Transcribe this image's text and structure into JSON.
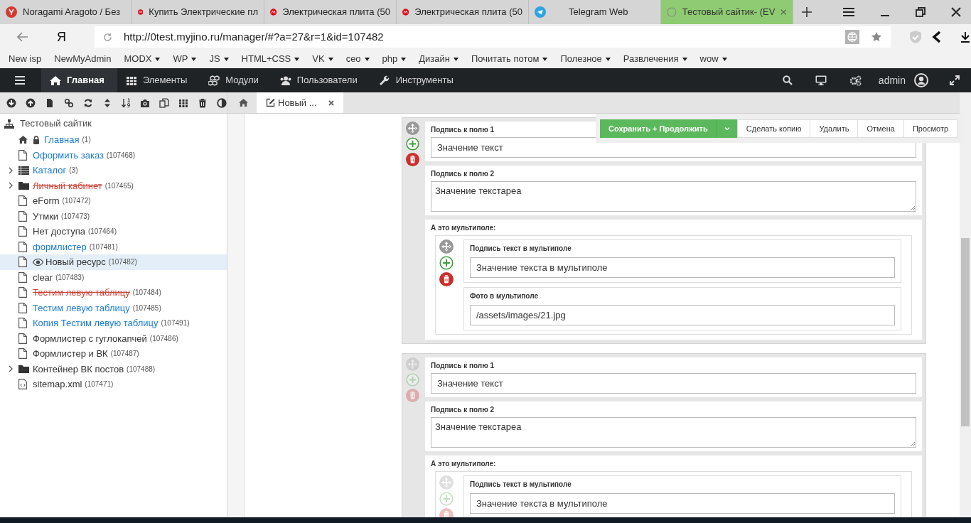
{
  "browser": {
    "tabs": [
      {
        "kind": "yandex",
        "title": "Noragami Aragoto / Без",
        "selected": false
      },
      {
        "kind": "mvideo",
        "title": "Купить Электрические пл",
        "selected": false
      },
      {
        "kind": "mvideo",
        "title": "Электрическая плита (50",
        "selected": false
      },
      {
        "kind": "mvideo",
        "title": "Электрическая плита (50",
        "selected": false
      },
      {
        "kind": "telegram",
        "title": "Telegram Web",
        "selected": false
      },
      {
        "kind": "evo",
        "title": "Тестовый сайтик- (EV",
        "selected": true
      }
    ],
    "logo": "Я",
    "address": "http://0test.myjino.ru/manager/#?a=27&r=1&id=107482",
    "bookmarks": [
      {
        "label": "New isp",
        "menu": false
      },
      {
        "label": "NewMyAdmin",
        "menu": false
      },
      {
        "label": "MODX",
        "menu": true
      },
      {
        "label": "WP",
        "menu": true
      },
      {
        "label": "JS",
        "menu": true
      },
      {
        "label": "HTML+CSS",
        "menu": true
      },
      {
        "label": "VK",
        "menu": true
      },
      {
        "label": "ceo",
        "menu": true
      },
      {
        "label": "php",
        "menu": true
      },
      {
        "label": "Дизайн",
        "menu": true
      },
      {
        "label": "Почитать потом",
        "menu": true
      },
      {
        "label": "Полезное",
        "menu": true
      },
      {
        "label": "Развлечения",
        "menu": true
      },
      {
        "label": "wow",
        "menu": true
      }
    ]
  },
  "manager": {
    "nav": [
      {
        "label": "Главная",
        "selected": true
      },
      {
        "label": "Элементы",
        "selected": false
      },
      {
        "label": "Модули",
        "selected": false
      },
      {
        "label": "Пользователи",
        "selected": false
      },
      {
        "label": "Инструменты",
        "selected": false
      }
    ],
    "user": "admin"
  },
  "tree": {
    "root": "Тестовый сайтик",
    "items": [
      {
        "kind": "home",
        "name": "Главная",
        "id": "(1)",
        "link": true,
        "deleted": false,
        "expandable": false,
        "selected": false,
        "locked": true,
        "viewing": false
      },
      {
        "kind": "doc",
        "name": "Оформить заказ",
        "id": "(107468)",
        "link": true,
        "deleted": false,
        "expandable": false,
        "selected": false,
        "locked": false,
        "viewing": false
      },
      {
        "kind": "list",
        "name": "Каталог",
        "id": "(3)",
        "link": true,
        "deleted": false,
        "expandable": true,
        "selected": false,
        "locked": false,
        "viewing": false
      },
      {
        "kind": "folder",
        "name": "Личный кабинет",
        "id": "(107465)",
        "link": false,
        "deleted": true,
        "expandable": true,
        "selected": false,
        "locked": false,
        "viewing": false
      },
      {
        "kind": "doc",
        "name": "eForm",
        "id": "(107472)",
        "link": false,
        "deleted": false,
        "expandable": false,
        "selected": false,
        "locked": false,
        "viewing": false
      },
      {
        "kind": "doc",
        "name": "Утмки",
        "id": "(107473)",
        "link": false,
        "deleted": false,
        "expandable": false,
        "selected": false,
        "locked": false,
        "viewing": false
      },
      {
        "kind": "doc",
        "name": "Нет доступа",
        "id": "(107464)",
        "link": false,
        "deleted": false,
        "expandable": false,
        "selected": false,
        "locked": false,
        "viewing": false
      },
      {
        "kind": "doc",
        "name": "формлистер",
        "id": "(107481)",
        "link": true,
        "deleted": false,
        "expandable": false,
        "selected": false,
        "locked": false,
        "viewing": false
      },
      {
        "kind": "doc",
        "name": "Новый ресурс",
        "id": "(107482)",
        "link": false,
        "deleted": false,
        "expandable": false,
        "selected": true,
        "locked": false,
        "viewing": true
      },
      {
        "kind": "doc",
        "name": "clear",
        "id": "(107483)",
        "link": false,
        "deleted": false,
        "expandable": false,
        "selected": false,
        "locked": false,
        "viewing": false
      },
      {
        "kind": "doc",
        "name": "Тестим левую таблицу",
        "id": "(107484)",
        "link": false,
        "deleted": true,
        "expandable": false,
        "selected": false,
        "locked": false,
        "viewing": false
      },
      {
        "kind": "doc",
        "name": "Тестим левую таблицу",
        "id": "(107485)",
        "link": true,
        "deleted": false,
        "expandable": false,
        "selected": false,
        "locked": false,
        "viewing": false
      },
      {
        "kind": "doc",
        "name": "Копия Тестим левую таблицу",
        "id": "(107491)",
        "link": true,
        "deleted": false,
        "expandable": false,
        "selected": false,
        "locked": false,
        "viewing": false
      },
      {
        "kind": "doc",
        "name": "Формлистер с гуглокапчей",
        "id": "(107486)",
        "link": false,
        "deleted": false,
        "expandable": false,
        "selected": false,
        "locked": false,
        "viewing": false
      },
      {
        "kind": "doc",
        "name": "Формлистер и ВК",
        "id": "(107487)",
        "link": false,
        "deleted": false,
        "expandable": false,
        "selected": false,
        "locked": false,
        "viewing": false
      },
      {
        "kind": "folder",
        "name": "Контейнер ВК постов",
        "id": "(107488)",
        "link": false,
        "deleted": false,
        "expandable": true,
        "selected": false,
        "locked": false,
        "viewing": false
      },
      {
        "kind": "code",
        "name": "sitemap.xml",
        "id": "(107471)",
        "link": false,
        "deleted": false,
        "expandable": false,
        "selected": false,
        "locked": false,
        "viewing": false
      }
    ]
  },
  "content": {
    "tabs": [
      {
        "kind": "home",
        "selected": false
      },
      {
        "kind": "doc",
        "label": "Новый ...",
        "selected": true
      }
    ],
    "actions": [
      {
        "kind": "primary",
        "label": "Сохранить + Продолжить"
      },
      {
        "kind": "dropdown"
      },
      {
        "kind": "plain",
        "label": "Сделать копию"
      },
      {
        "kind": "plain",
        "label": "Удалить"
      },
      {
        "kind": "plain",
        "label": "Отмена"
      },
      {
        "kind": "plain",
        "label": "Просмотр"
      }
    ],
    "blocks": [
      {
        "active": true,
        "fields": [
          {
            "kind": "text",
            "label": "Подпись к полю 1",
            "value": "Значение текст"
          },
          {
            "kind": "textarea",
            "label": "Подпись к полю 2",
            "value": "Значение текстареа"
          },
          {
            "kind": "multi",
            "label": "А это мультиполе:",
            "items": [
              {
                "active": true,
                "fields": [
                  {
                    "label": "Подпись текст в мультиполе",
                    "value": "Значение текста в мультиполе"
                  },
                  {
                    "label": "Фото в мультиполе",
                    "value": "/assets/images/21.jpg"
                  }
                ]
              }
            ]
          }
        ]
      },
      {
        "active": false,
        "fields": [
          {
            "kind": "text",
            "label": "Подпись к полю 1",
            "value": "Значение текст"
          },
          {
            "kind": "textarea",
            "label": "Подпись к полю 2",
            "value": "Значение текстареа"
          },
          {
            "kind": "multi",
            "label": "А это мультиполе:",
            "items": [
              {
                "active": false,
                "fields": [
                  {
                    "label": "Подпись текст в мультиполе",
                    "value": "Значение текста в мультиполе"
                  }
                ]
              }
            ]
          }
        ]
      }
    ]
  }
}
